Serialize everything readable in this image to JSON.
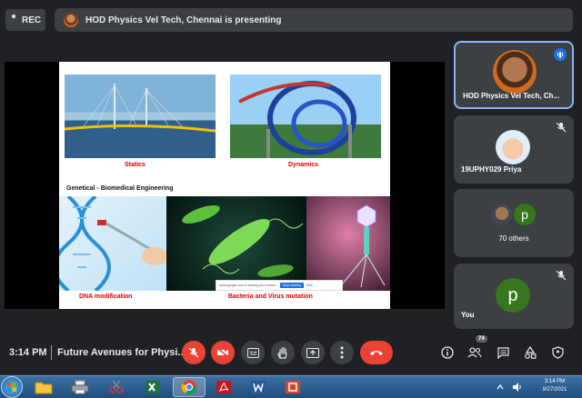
{
  "recording": {
    "label": "REC"
  },
  "presenting": {
    "text": "HOD Physics Vel Tech, Chennai is presenting"
  },
  "slide": {
    "captions": {
      "statics": "Statics",
      "dynamics": "Dynamics",
      "heading": "Genetical - Biomedical Engineering",
      "dna": "DNA modification",
      "bacteria": "Bacteria and Virus mutation"
    },
    "share_toast": {
      "text": "meet.google.com is sharing your screen.",
      "stop": "Stop sharing",
      "hide": "Hide"
    }
  },
  "participants": {
    "presenter": {
      "name": "HOD Physics Vel Tech, Ch..."
    },
    "priya": {
      "name": "19UPHY029 Priya"
    },
    "others": {
      "name": "70 others",
      "avatar_letter": "p"
    },
    "you": {
      "name": "You",
      "avatar_letter": "p"
    }
  },
  "bottom_bar": {
    "time": "3:14 PM",
    "meeting_title": "Future Avenues for Physi...",
    "participant_count": "74"
  },
  "taskbar": {
    "clock_time": "3:14 PM",
    "clock_date": "9/27/2021"
  },
  "colors": {
    "accent": "#1a73e8",
    "danger": "#ea4335",
    "surface": "#3c4043",
    "background": "#202124",
    "caption_red": "#e00000",
    "avatar_green": "#38761d"
  }
}
